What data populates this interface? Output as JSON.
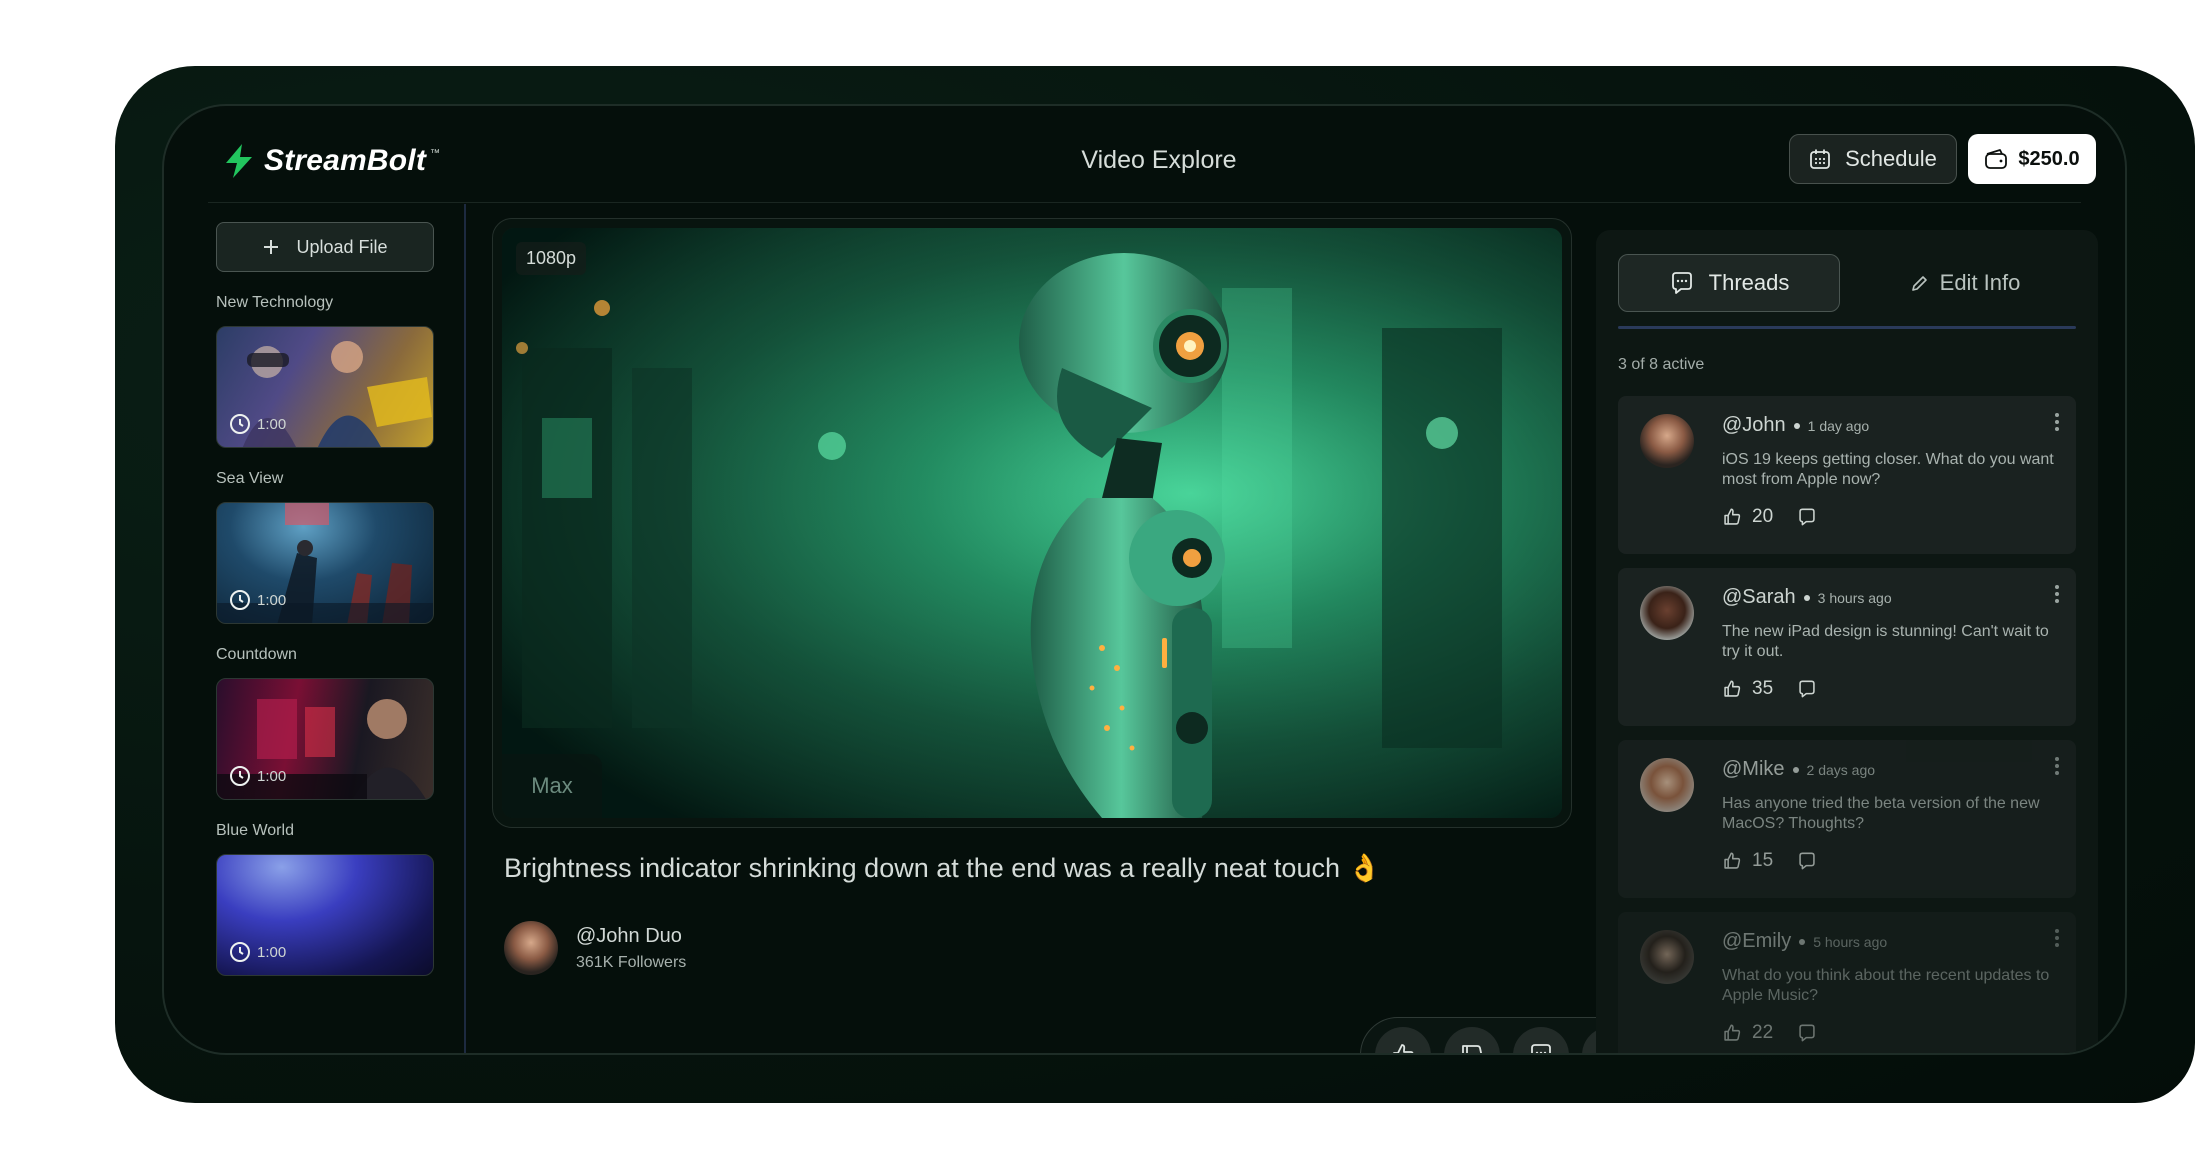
{
  "app": {
    "name": "StreamBolt",
    "trademark": "™",
    "page_title": "Video Explore"
  },
  "header": {
    "schedule_label": "Schedule",
    "balance": "$250.0"
  },
  "sidebar": {
    "upload_label": "Upload File",
    "categories": [
      {
        "label": "New Technology",
        "duration": "1:00"
      },
      {
        "label": "Sea View",
        "duration": "1:00"
      },
      {
        "label": "Countdown",
        "duration": "1:00"
      },
      {
        "label": "Blue World",
        "duration": "1:00"
      }
    ]
  },
  "video": {
    "resolution": "1080p",
    "quality_label": "Max",
    "caption": "Brightness indicator shrinking down at the end was a really neat touch 👌",
    "author_handle": "@John Duo",
    "author_followers": "361K Followers"
  },
  "actions": [
    "thumbs-up-icon",
    "thumbs-down-icon",
    "comment-icon",
    "save-icon",
    "download-icon"
  ],
  "panel": {
    "tab_threads": "Threads",
    "tab_edit": "Edit Info",
    "active_count": "3 of 8 active",
    "threads": [
      {
        "user": "@John",
        "time": "1 day ago",
        "text": "iOS 19 keeps getting closer. What do you want most from Apple now?",
        "likes": "20"
      },
      {
        "user": "@Sarah",
        "time": "3 hours ago",
        "text": "The new iPad design is stunning! Can't wait to try it out.",
        "likes": "35"
      },
      {
        "user": "@Mike",
        "time": "2 days ago",
        "text": "Has anyone tried the beta version of the new MacOS? Thoughts?",
        "likes": "15"
      },
      {
        "user": "@Emily",
        "time": "5 hours ago",
        "text": "What do you think about the recent updates to Apple Music?",
        "likes": "22"
      }
    ]
  },
  "colors": {
    "accent": "#22c55e",
    "background": "#050f0b",
    "panel": "#1a2220"
  }
}
